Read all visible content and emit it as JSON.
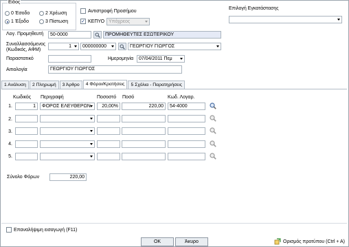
{
  "eidos": {
    "legend": "Είδος",
    "options": [
      {
        "label": "0 Έσοδο",
        "selected": false
      },
      {
        "label": "2 Χρέωση",
        "selected": false
      },
      {
        "label": "1 Έξοδο",
        "selected": true
      },
      {
        "label": "3 Πίστωση",
        "selected": false
      }
    ]
  },
  "antistrofi": {
    "label": "Αντιστροφή Προσήμου",
    "checked": false
  },
  "kepyo": {
    "label": "ΚΕΠΥΟ",
    "checked": true,
    "select_value": "Υπόχρεος"
  },
  "installation": {
    "label": "Επιλογή Εγκατάστασης",
    "value": ""
  },
  "supplier": {
    "label": "Λογ. Προμηθευτή",
    "code": "50-0000",
    "name": "ΠΡΟΜΗΘΕΥΤΕΣ ΕΣΩΤΕΡΙΚΟΥ"
  },
  "counterparty": {
    "label": "Συναλλασσόμενος",
    "label2": "(Κωδικός, ΑΦΜ)",
    "code": "1",
    "afm": "000000000",
    "name": "ΓΕΩΡΓΙΟΥ ΓΙΩΡΓΟΣ"
  },
  "document": {
    "label": "Παραστατικό",
    "value": ""
  },
  "date": {
    "label": "Ημερομηνία",
    "value": "07/04/2011 Πεμ"
  },
  "reason": {
    "label": "Αιτιολογία",
    "value": "ΓΕΩΡΓΙΟΥ ΓΙΩΡΓΟΣ"
  },
  "tabs": [
    {
      "label": "1 Ανάλυση",
      "active": false
    },
    {
      "label": "2 Πληρωμή",
      "active": false
    },
    {
      "label": "3 Άρθρο",
      "active": false
    },
    {
      "label": "4 Φόροι/Κρατήσεις",
      "active": true
    },
    {
      "label": "5 Σχόλια - Παρατηρήσεις",
      "active": false
    }
  ],
  "taxes": {
    "headers": {
      "code": "Κωδικός",
      "description": "Περιγραφή",
      "percent": "Ποσοστό",
      "amount": "Ποσό",
      "account": "Κωδ. Λογαρ."
    },
    "rows": [
      {
        "num": "1.",
        "code": "1",
        "description": "ΦΟΡΟΣ ΕΛΕΥΘΕΡΩΝ",
        "percent": "20,00%",
        "amount": "220,00",
        "account": "54-4000"
      },
      {
        "num": "2.",
        "code": "",
        "description": "",
        "percent": "",
        "amount": "",
        "account": ""
      },
      {
        "num": "3.",
        "code": "",
        "description": "",
        "percent": "",
        "amount": "",
        "account": ""
      },
      {
        "num": "4.",
        "code": "",
        "description": "",
        "percent": "",
        "amount": "",
        "account": ""
      },
      {
        "num": "5.",
        "code": "",
        "description": "",
        "percent": "",
        "amount": "",
        "account": ""
      }
    ],
    "total_label": "Σύνολο Φόρων",
    "total_value": "220,00"
  },
  "repeat_entry": {
    "label": "Επαναλήψιμη εισαγωγή (F11)",
    "checked": false
  },
  "buttons": {
    "ok": "OK",
    "cancel": "Άκυρο",
    "template": "Ορισμός προτύπου (Ctrl + A)"
  },
  "icons": {
    "lookup": "magnifier-icon",
    "template": "template-icon"
  },
  "colors": {
    "accent_blue": "#e5eaf6",
    "radio_dot": "#1f3f86"
  }
}
